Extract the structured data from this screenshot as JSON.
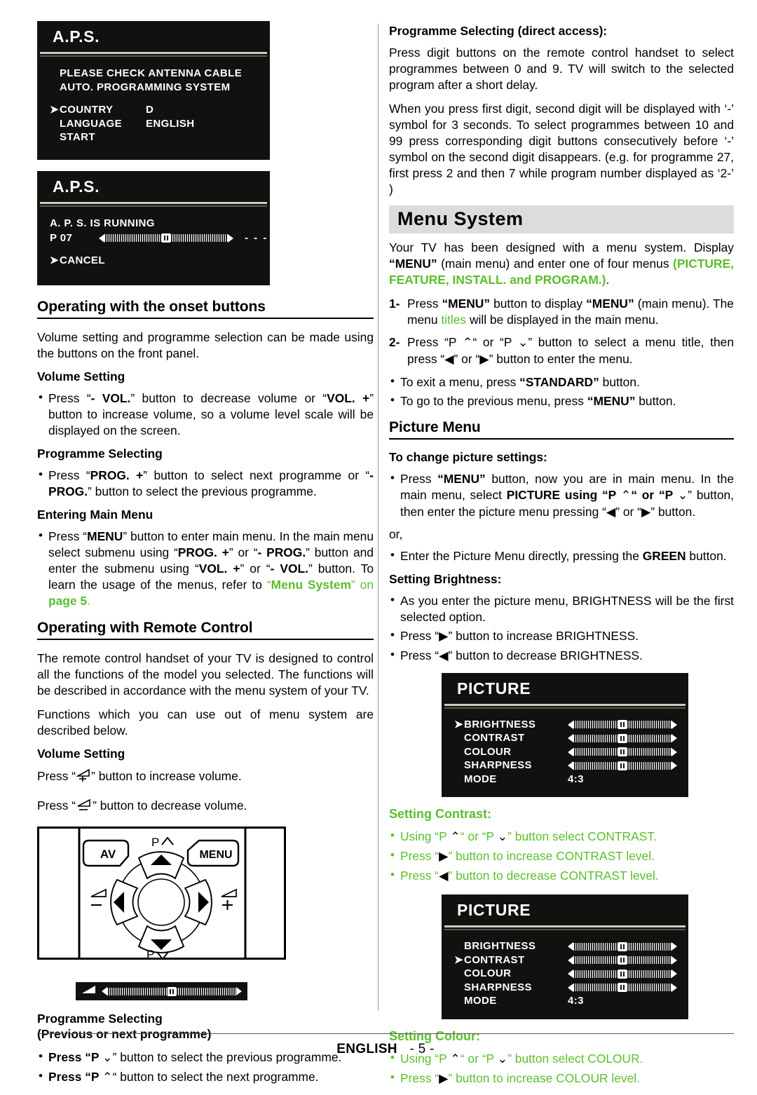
{
  "colors": {
    "green": "#5cbe2e",
    "banner_bg": "#dcdcdc",
    "osd_bg": "#111110"
  },
  "osd_aps_1": {
    "title": "A.P.S.",
    "message_line_1": "PLEASE  CHECK  ANTENNA  CABLE",
    "message_line_2": "AUTO.  PROGRAMMING  SYSTEM",
    "rows": [
      {
        "cursor": true,
        "label": "COUNTRY",
        "value": "D"
      },
      {
        "cursor": false,
        "label": "LANGUAGE",
        "value": "ENGLISH"
      },
      {
        "cursor": false,
        "label": "START",
        "value": ""
      }
    ]
  },
  "osd_aps_2": {
    "title": "A.P.S.",
    "status": "A.  P.  S.  IS  RUNNING",
    "programme": "P  07",
    "dashes": "- - -",
    "cancel": "CANCEL"
  },
  "left": {
    "h_onset": "Operating with the onset buttons",
    "onset_intro": "Volume setting and programme selection can be made using the buttons on the front panel.",
    "sub_volume": "Volume Setting",
    "volume_bullet": "Press “- VOL.” button to decrease volume or “VOL. +” button to increase volume, so a volume level scale will be displayed on the screen.",
    "sub_prog": "Programme Selecting",
    "prog_bullet": "Press “PROG. +” button to select next programme or “- PROG.” button to select the previous programme.",
    "sub_main_menu": "Entering Main Menu",
    "main_menu_bullet": "Press “MENU” button to enter main menu. In the main menu select submenu using “PROG. +” or “- PROG.” button and enter the submenu using “VOL. +” or “- VOL.”  button. To learn the usage of the menus, refer to “Menu System” on page 5.",
    "main_menu_link": "Menu System",
    "main_menu_page": "page 5",
    "h_remote": "Operating with Remote Control",
    "remote_p1": "The remote control handset of your TV is designed to control all the functions of the model you selected. The functions will be described  in accordance with the menu system of your TV.",
    "remote_p2": "Functions which you can use out of menu system are described below.",
    "sub_volume2": "Volume Setting",
    "vol_up_text_a": "Press “",
    "vol_up_text_b": "” button to increase volume.",
    "vol_dn_text_a": "Press “",
    "vol_dn_text_b": "”  button  to decrease volume.",
    "sub_prog2_l1": "Programme Selecting",
    "sub_prog2_l2": "(Previous or next programme)",
    "prog_prev_a": "Press “P ",
    "prog_prev_b": "” button to select the previous programme.",
    "prog_next_a": "Press “P ",
    "prog_next_b": "“ button to select the next programme."
  },
  "remote": {
    "av_label": "AV",
    "menu_label": "MENU",
    "p_up_label": "P",
    "p_down_label": "P",
    "vol_minus": "−",
    "vol_plus": "+"
  },
  "right": {
    "sub_direct": "Programme Selecting (direct access):",
    "direct_p1": "Press digit buttons on the remote control handset to select programmes between 0 and 9. TV will switch to the selected program after a short delay.",
    "direct_p2": "When you press first digit, second digit will be displayed with ‘-’ symbol for 3 seconds. To select programmes between 10 and 99 press corresponding digit buttons consecutively before ‘-’ symbol on the second digit disappears. (e.g. for programme 27, first press 2 and then 7 while program number displayed as ‘2-’ )",
    "banner_menu_system": "Menu System",
    "ms_intro_a": "Your TV has been designed with a menu system. Display ",
    "ms_intro_menu": "“MENU”",
    "ms_intro_b": " (main menu) and enter one of four menus ",
    "ms_intro_green": "(PICTURE, FEATURE, INSTALL. and PROGRAM.)",
    "ms_intro_c": ".",
    "ms_step1_n": "1-",
    "ms_step1_a": "Press ",
    "ms_step1_menu": "“MENU”",
    "ms_step1_b": " button to display ",
    "ms_step1_menu2": "“MENU”",
    "ms_step1_c": " (main menu). The menu ",
    "ms_step1_titles": "titles",
    "ms_step1_d": " will be displayed in the main menu.",
    "ms_step2_n": "2-",
    "ms_step2_a": "Press “P ",
    "ms_step2_b": "“ or “P ",
    "ms_step2_c": "” button to select a menu title, then press “",
    "ms_step2_d": "” or “",
    "ms_step2_e": "” button to enter the menu.",
    "ms_b1_a": "To exit a menu, press ",
    "ms_b1_std": "“STANDARD”",
    "ms_b1_b": " button.",
    "ms_b2_a": "To go to the previous menu, press ",
    "ms_b2_menu": "“MENU”",
    "ms_b2_b": " button.",
    "h_picture_menu": "Picture Menu",
    "sub_change": "To change picture settings:",
    "change_b1_a": "Press ",
    "change_b1_menu": "“MENU”",
    "change_b1_b": " button, now you are in main menu. In the main menu, select ",
    "change_b1_picture": "PICTURE",
    "change_b1_c": " using “P ",
    "change_b1_d": "“ or “P ",
    "change_b1_e": "” button, then enter the picture menu pressing “",
    "change_b1_f": "” or “",
    "change_b1_g": "” button.",
    "or_text": "or,",
    "change_b2_a": "Enter the Picture Menu directly, pressing the ",
    "change_b2_green_btn": "GREEN",
    "change_b2_b": " button.",
    "sub_brightness": "Setting Brightness:",
    "bright_b1": "As you enter the picture menu, BRIGHTNESS will be the first selected option.",
    "bright_b2_a": "Press “",
    "bright_b2_b": "” button to increase BRIGHTNESS.",
    "bright_b3_a": "Press “",
    "bright_b3_b": "” button  to decrease BRIGHTNESS.",
    "sub_contrast": "Setting  Contrast:",
    "contrast_b1_a": "Using “P ",
    "contrast_b1_b": "“ or “P ",
    "contrast_b1_c": "” button select CONTRAST.",
    "contrast_b2_a": "Press “",
    "contrast_b2_b": "” button to increase CONTRAST level.",
    "contrast_b3_a": "Press “",
    "contrast_b3_b": "” button to decrease CONTRAST level.",
    "sub_colour": "Setting Colour:",
    "colour_b1_a": "Using “P ",
    "colour_b1_b": "“ or “P ",
    "colour_b1_c": "” button select COLOUR.",
    "colour_b2_a": "Press “",
    "colour_b2_b": "” button to increase COLOUR level."
  },
  "osd_picture_1": {
    "title": "PICTURE",
    "rows": [
      {
        "cursor": true,
        "label": "BRIGHTNESS",
        "type": "slider",
        "value": ""
      },
      {
        "cursor": false,
        "label": "CONTRAST",
        "type": "slider",
        "value": ""
      },
      {
        "cursor": false,
        "label": "COLOUR",
        "type": "slider",
        "value": ""
      },
      {
        "cursor": false,
        "label": "SHARPNESS",
        "type": "slider",
        "value": ""
      },
      {
        "cursor": false,
        "label": "MODE",
        "type": "text",
        "value": "4:3"
      }
    ]
  },
  "osd_picture_2": {
    "title": "PICTURE",
    "rows": [
      {
        "cursor": false,
        "label": "BRIGHTNESS",
        "type": "slider",
        "value": ""
      },
      {
        "cursor": true,
        "label": "CONTRAST",
        "type": "slider",
        "value": ""
      },
      {
        "cursor": false,
        "label": "COLOUR",
        "type": "slider",
        "value": ""
      },
      {
        "cursor": false,
        "label": "SHARPNESS",
        "type": "slider",
        "value": ""
      },
      {
        "cursor": false,
        "label": "MODE",
        "type": "text",
        "value": "4:3"
      }
    ]
  },
  "footer": {
    "language": "ENGLISH",
    "page": "- 5 -"
  }
}
